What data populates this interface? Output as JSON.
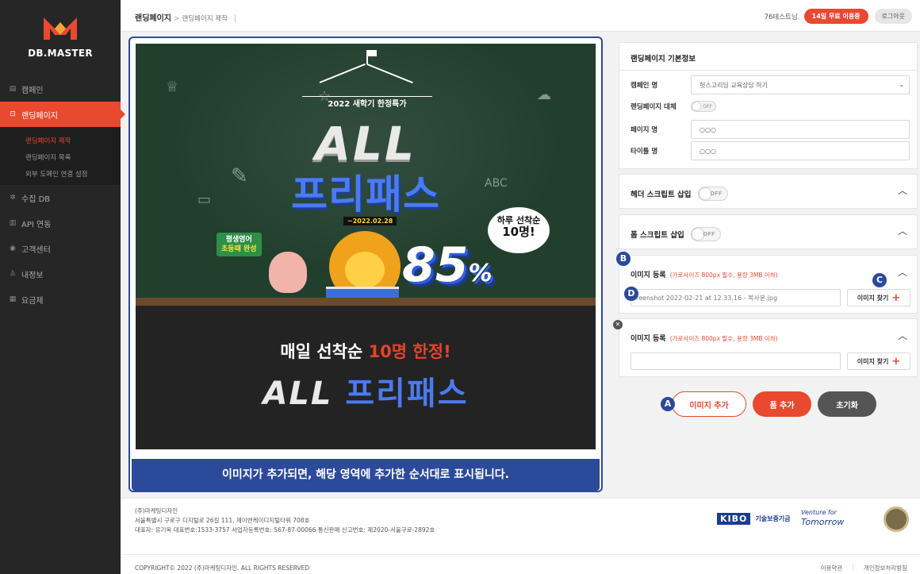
{
  "brand": {
    "name": "DB.MASTER",
    "accent": "#e8492f",
    "marker": "#2c4a9a"
  },
  "sidebar": {
    "items": [
      {
        "icon": "campaign-icon",
        "label": "캠페인"
      },
      {
        "icon": "landing-page-icon",
        "label": "랜딩페이지",
        "active": true
      },
      {
        "icon": "collect-db-icon",
        "label": "수집 DB"
      },
      {
        "icon": "api-icon",
        "label": "API 연동"
      },
      {
        "icon": "support-icon",
        "label": "고객센터"
      },
      {
        "icon": "user-icon",
        "label": "내정보"
      },
      {
        "icon": "billing-icon",
        "label": "요금제"
      }
    ],
    "sub_items": [
      {
        "label": "랜딩페이지 제작",
        "active": true
      },
      {
        "label": "랜딩페이지 목록"
      },
      {
        "label": "외부 도메인 연결 설정"
      }
    ]
  },
  "header": {
    "breadcrumb_root": "랜딩페이지",
    "breadcrumb_sep": ">",
    "breadcrumb_current": "랜딩페이지 제작",
    "breadcrumb_bar": "|",
    "user": "76테스트님",
    "trial": "14일 무료 이용중",
    "logout": "로그아웃"
  },
  "preview": {
    "banner_tag": "2022 새학기 한정특가",
    "headline_1": "ALL",
    "headline_2": "프리패스",
    "date": "~2022.02.28",
    "bubble_1": "하루 선착순",
    "bubble_2": "10명!",
    "sticker_1": "평생영어",
    "sticker_2": "초등때 완성",
    "percent": "85",
    "percent_sign": "%",
    "chalk_abc": "ABC",
    "lower_1_a": "매일 선착순 ",
    "lower_1_b": "10명 한정!",
    "lower_2_a": "ALL ",
    "lower_2_b": "프리패스",
    "caption": "이미지가 추가되면, 해당 영역에 추가한 순서대로 표시됩니다."
  },
  "basic": {
    "title": "랜딩페이지 기본정보",
    "campaign_label": "캠페인 명",
    "campaign_value": "헛스고리딩 교육상담 하기",
    "replace_label": "랜딩페이지 대체",
    "replace_toggle": "OFF",
    "page_label": "페이지 명",
    "page_value": "○○○",
    "title_label": "타이틀 명",
    "title_value": "○○○"
  },
  "header_script": {
    "title": "헤더 스크립트 삽입",
    "toggle": "OFF"
  },
  "form_script": {
    "title": "폼 스크립트 삽입",
    "toggle": "OFF"
  },
  "image_1": {
    "title": "이미지 등록",
    "note": "(가로사이즈 800px 필수, 용량 3MB 이하)",
    "file": "reenshot 2022-02-21 at 12.33.16 - 복사본.jpg",
    "find": "이미지 찾기"
  },
  "image_2": {
    "title": "이미지 등록",
    "note": "(가로사이즈 800px 필수, 용량 3MB 이하)",
    "file": "",
    "find": "이미지 찾기"
  },
  "actions": {
    "add_image": "이미지 추가",
    "add_form": "폼 추가",
    "reset": "초기화"
  },
  "markers": {
    "a": "A",
    "b": "B",
    "c": "C",
    "d": "D"
  },
  "footer": {
    "company": "(주)마케팅디자인",
    "address": "서울특별시 구로구 디지털로 26길 111, 제이앤케이디지털타워 708호",
    "biz": "대표자: 유기옥   대표번호:1533-3757   사업자등록번호: 567-87-00066   통신판매 신고번호: 제2020-서울구로-2892호",
    "copyright": "COPYRIGHT© 2022 (주)마케팅디자인. ALL RIGHTS RESERVED",
    "terms": "이용약관",
    "privacy": "개인정보처리방침",
    "kibo": "KIBO",
    "kibo_text": "기술보증기금",
    "venture_1": "Venture for",
    "venture_2": "Tomorrow"
  }
}
